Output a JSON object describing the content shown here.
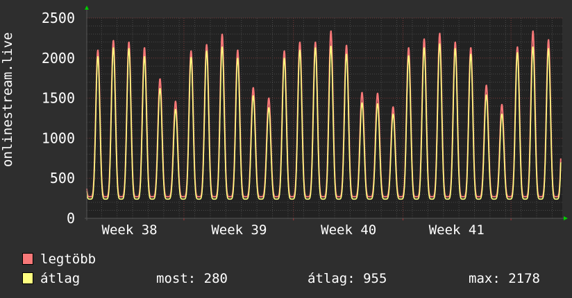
{
  "chart_data": {
    "type": "line",
    "ylabel": "onlinestream.live",
    "ylim": [
      0,
      2500
    ],
    "yticks": [
      0,
      500,
      1000,
      1500,
      2000,
      2500
    ],
    "x_unit": "days",
    "xlim": [
      0,
      30.6
    ],
    "week_boundaries_days": [
      6.25,
      13.3,
      20.35,
      27.3
    ],
    "xtick_labels": [
      "Week 38",
      "Week 39",
      "Week 40",
      "Week 41"
    ],
    "daily_peak_offset_days": 0.71,
    "grid": true,
    "series": [
      {
        "name": "legtöbb",
        "color": "#f87878",
        "trough": 270,
        "daily_peaks": [
          2100,
          2220,
          2200,
          2130,
          1740,
          1460,
          2090,
          2170,
          2300,
          2100,
          1630,
          1500,
          2090,
          2200,
          2200,
          2340,
          2160,
          1570,
          1560,
          1390,
          2130,
          2240,
          2310,
          2200,
          2130,
          1660,
          1420,
          2140,
          2340,
          2230
        ]
      },
      {
        "name": "átlag",
        "color": "#ffff80",
        "trough": 240,
        "daily_peaks": [
          2020,
          2130,
          2120,
          2020,
          1620,
          1360,
          2010,
          2090,
          2140,
          2000,
          1530,
          1380,
          2000,
          2100,
          2130,
          2150,
          2050,
          1440,
          1430,
          1300,
          2030,
          2130,
          2180,
          2120,
          2050,
          1540,
          1300,
          2070,
          2140,
          2120
        ]
      }
    ],
    "legend": {
      "items": [
        "legtöbb",
        "átlag"
      ],
      "stats": {
        "most_label": "most:",
        "most": "280",
        "avg_label": "átlag:",
        "avg": "955",
        "max_label": "max:",
        "max": "2178"
      }
    }
  }
}
